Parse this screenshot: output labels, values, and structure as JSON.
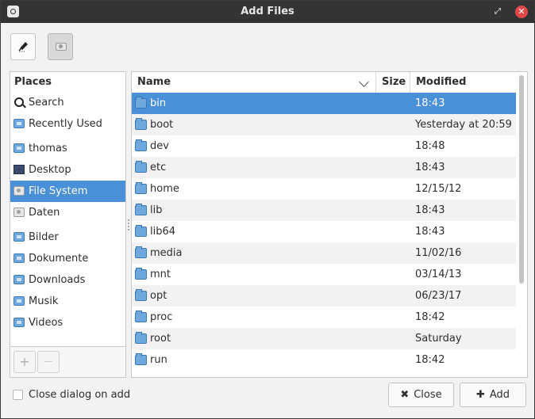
{
  "window": {
    "title": "Add Files"
  },
  "sidebar": {
    "header": "Places",
    "items": [
      {
        "label": "Search",
        "icon": "search-icon"
      },
      {
        "label": "Recently Used",
        "icon": "recent-icon"
      },
      {
        "label": "thomas",
        "icon": "home-icon"
      },
      {
        "label": "Desktop",
        "icon": "desktop-icon"
      },
      {
        "label": "File System",
        "icon": "drive-icon",
        "selected": true
      },
      {
        "label": "Daten",
        "icon": "drive-icon"
      },
      {
        "label": "Bilder",
        "icon": "folder-pictures-icon"
      },
      {
        "label": "Dokumente",
        "icon": "folder-documents-icon"
      },
      {
        "label": "Downloads",
        "icon": "folder-download-icon"
      },
      {
        "label": "Musik",
        "icon": "folder-music-icon"
      },
      {
        "label": "Videos",
        "icon": "folder-videos-icon"
      }
    ],
    "add_label": "+",
    "remove_label": "—"
  },
  "files": {
    "columns": {
      "name": "Name",
      "size": "Size",
      "modified": "Modified"
    },
    "rows": [
      {
        "name": "bin",
        "size": "",
        "modified": "18:43",
        "selected": true
      },
      {
        "name": "boot",
        "size": "",
        "modified": "Yesterday at 20:59"
      },
      {
        "name": "dev",
        "size": "",
        "modified": "18:48"
      },
      {
        "name": "etc",
        "size": "",
        "modified": "18:43"
      },
      {
        "name": "home",
        "size": "",
        "modified": "12/15/12"
      },
      {
        "name": "lib",
        "size": "",
        "modified": "18:43"
      },
      {
        "name": "lib64",
        "size": "",
        "modified": "18:43"
      },
      {
        "name": "media",
        "size": "",
        "modified": "11/02/16"
      },
      {
        "name": "mnt",
        "size": "",
        "modified": "03/14/13"
      },
      {
        "name": "opt",
        "size": "",
        "modified": "06/23/17"
      },
      {
        "name": "proc",
        "size": "",
        "modified": "18:42"
      },
      {
        "name": "root",
        "size": "",
        "modified": "Saturday"
      },
      {
        "name": "run",
        "size": "",
        "modified": "18:42"
      }
    ]
  },
  "footer": {
    "checkbox_label": "Close dialog on add",
    "close_label": "Close",
    "add_label": "Add"
  },
  "colors": {
    "selection": "#4a90d9",
    "folder": "#6fa8dc",
    "titlebar": "#343434",
    "close_button": "#e0494a"
  }
}
